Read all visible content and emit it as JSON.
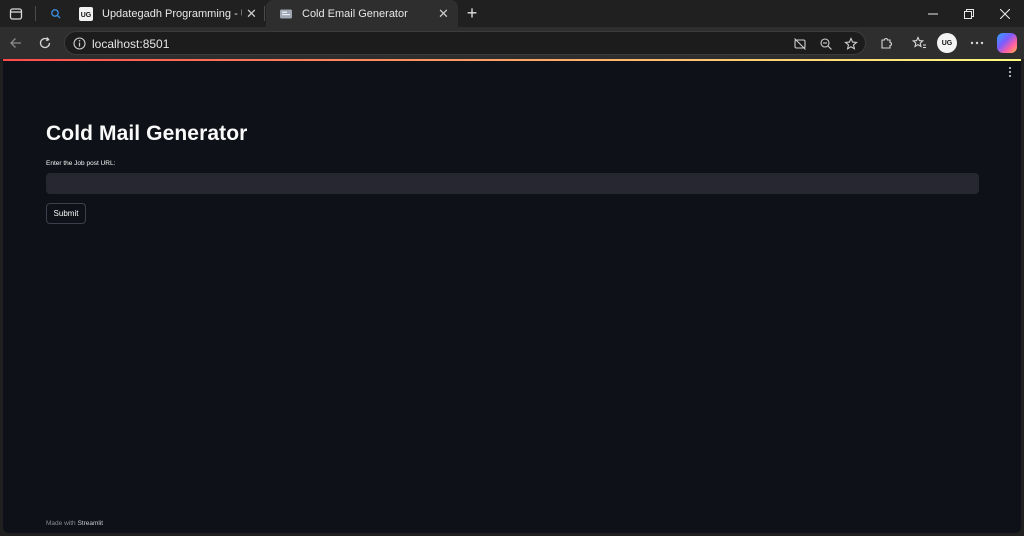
{
  "browser": {
    "tabs": [
      {
        "title": "Updategadh Programming - Updategadh",
        "favicon": "ug-logo-icon",
        "active": false
      },
      {
        "title": "Cold Email Generator",
        "favicon": "page-icon",
        "active": true
      }
    ],
    "address": {
      "url": "localhost:8501"
    },
    "profile_initials": "UG"
  },
  "app": {
    "title": "Cold Mail Generator",
    "input_label": "Enter the Job post URL:",
    "input_value": "",
    "input_placeholder": "",
    "submit_label": "Submit",
    "footer_prefix": "Made with",
    "footer_brand": "Streamlit"
  },
  "colors": {
    "app_background": "#0e1117",
    "input_background": "#262730",
    "text": "#fafafa",
    "browser_chrome": "#202020"
  }
}
